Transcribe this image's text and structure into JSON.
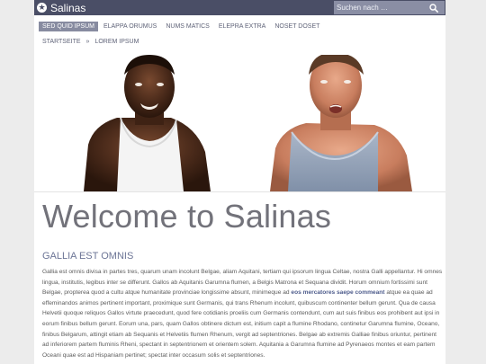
{
  "header": {
    "site_title": "Salinas",
    "search_placeholder": "Suchen nach …"
  },
  "nav": {
    "items": [
      {
        "label": "SED QUID IPSUM"
      },
      {
        "label": "ELAPPA ORUMUS"
      },
      {
        "label": "NUMS MATICS"
      },
      {
        "label": "ELEPRA EXTRA"
      },
      {
        "label": "NOSET DOSET"
      }
    ]
  },
  "breadcrumb": {
    "home": "STARTSEITE",
    "separator": "»",
    "current": "LOREM IPSUM"
  },
  "main": {
    "title": "Welcome to Salinas",
    "subtitle": "GALLIA EST OMNIS",
    "para_1": "Gallia est omnis divisa in partes tres, quarum unam incolunt Belgae, aliam Aquitani, tertiam qui ipsorum lingua Celtae, nostra Galli appellantur. Hi omnes lingua, institutis, legibus inter se differunt. Gallos ab Aquitanis Garumna flumen, a Belgis Matrona et Sequana dividit. Horum omnium fortissimi sunt Belgae, propterea quod a cultu atque humanitate provinciae longissime absunt, minimeque ad",
    "link_text": "eos mercatores saepe commeant",
    "para_2": "atque ea quae ad effeminandos animos pertinent important, proximique sunt Germanis, qui trans Rhenum incolunt, quibuscum continenter bellum gerunt. Qua de causa Helvetii quoque reliquos Gallos virtute praecedunt, quod fere cotidianis proeliis cum Germanis contendunt, cum aut suis finibus eos prohibent aut ipsi in eorum finibus bellum gerunt. Eorum una, pars, quam Gallos obtinere dictum est, initium capit a flumine Rhodano, continetur Garumna flumine, Oceano, finibus Belgarum, attingit etiam ab Sequanis et Helvetiis flumen Rhenum, vergit ad septentriones. Belgae ab extremis Galliae finibus oriuntur, pertinent ad inferiorem partem fluminis Rheni, spectant in septentrionem et orientem solem. Aquitania a Garumna flumine ad Pyrenaeos montes et eam partem Oceani quae est ad Hispaniam pertinet; spectat inter occasum solis et septentriones."
  },
  "colors": {
    "topbar": "#4a4e66",
    "nav_active": "#878ba0",
    "accent_text": "#6c7596"
  },
  "icons": {
    "logo": "star-circle-icon",
    "search": "search-icon"
  }
}
